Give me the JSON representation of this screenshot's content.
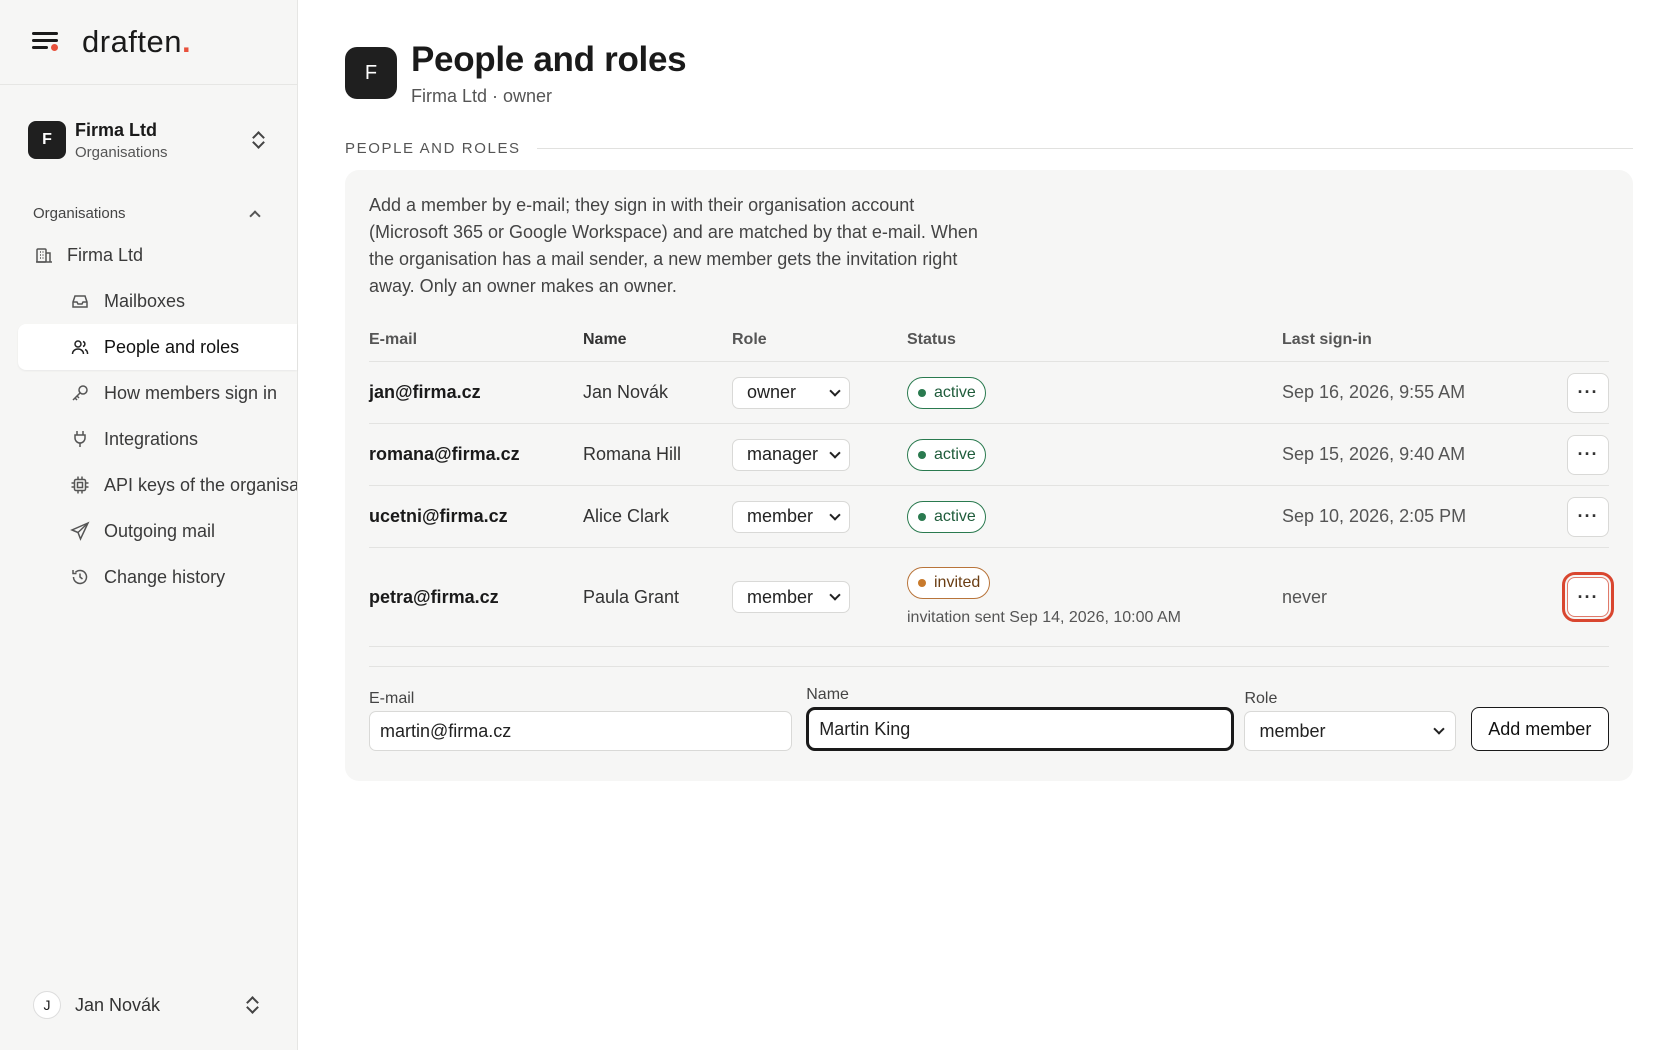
{
  "brand": {
    "name": "draften",
    "dot": "."
  },
  "org_switch": {
    "initial": "F",
    "name": "Firma Ltd",
    "sub": "Organisations"
  },
  "sidebar": {
    "section_label": "Organisations",
    "org_item": "Firma Ltd",
    "items": [
      {
        "label": "Mailboxes",
        "icon": "inbox-icon"
      },
      {
        "label": "People and roles",
        "icon": "users-icon",
        "active": true
      },
      {
        "label": "How members sign in",
        "icon": "key-icon"
      },
      {
        "label": "Integrations",
        "icon": "plug-icon"
      },
      {
        "label": "API keys of the organisation",
        "icon": "chip-icon"
      },
      {
        "label": "Outgoing mail",
        "icon": "send-icon"
      },
      {
        "label": "Change history",
        "icon": "history-icon"
      }
    ]
  },
  "user": {
    "initial": "J",
    "name": "Jan Novák"
  },
  "header": {
    "initial": "F",
    "title": "People and roles",
    "subtitle": "Firma Ltd · owner"
  },
  "section_label": "PEOPLE AND ROLES",
  "intro": "Add a member by e-mail; they sign in with their organisation account (Microsoft 365 or Google Workspace) and are matched by that e-mail. When the organisation has a mail sender, a new member gets the invitation right away. Only an owner makes an owner.",
  "table": {
    "headers": {
      "email": "E-mail",
      "name": "Name",
      "role": "Role",
      "status": "Status",
      "last": "Last sign-in"
    },
    "rows": [
      {
        "email": "jan@firma.cz",
        "name": "Jan Novák",
        "role": "owner",
        "status": "active",
        "last": "Sep 16, 2026, 9:55 AM"
      },
      {
        "email": "romana@firma.cz",
        "name": "Romana Hill",
        "role": "manager",
        "status": "active",
        "last": "Sep 15, 2026, 9:40 AM"
      },
      {
        "email": "ucetni@firma.cz",
        "name": "Alice Clark",
        "role": "member",
        "status": "active",
        "last": "Sep 10, 2026, 2:05 PM"
      },
      {
        "email": "petra@firma.cz",
        "name": "Paula Grant",
        "role": "member",
        "status": "invited",
        "status_note": "invitation sent Sep 14, 2026, 10:00 AM",
        "last": "never"
      }
    ],
    "more_label": "···"
  },
  "form": {
    "email_label": "E-mail",
    "email_value": "martin@firma.cz",
    "name_label": "Name",
    "name_value": "Martin King",
    "role_label": "Role",
    "role_value": "member",
    "submit": "Add member"
  }
}
